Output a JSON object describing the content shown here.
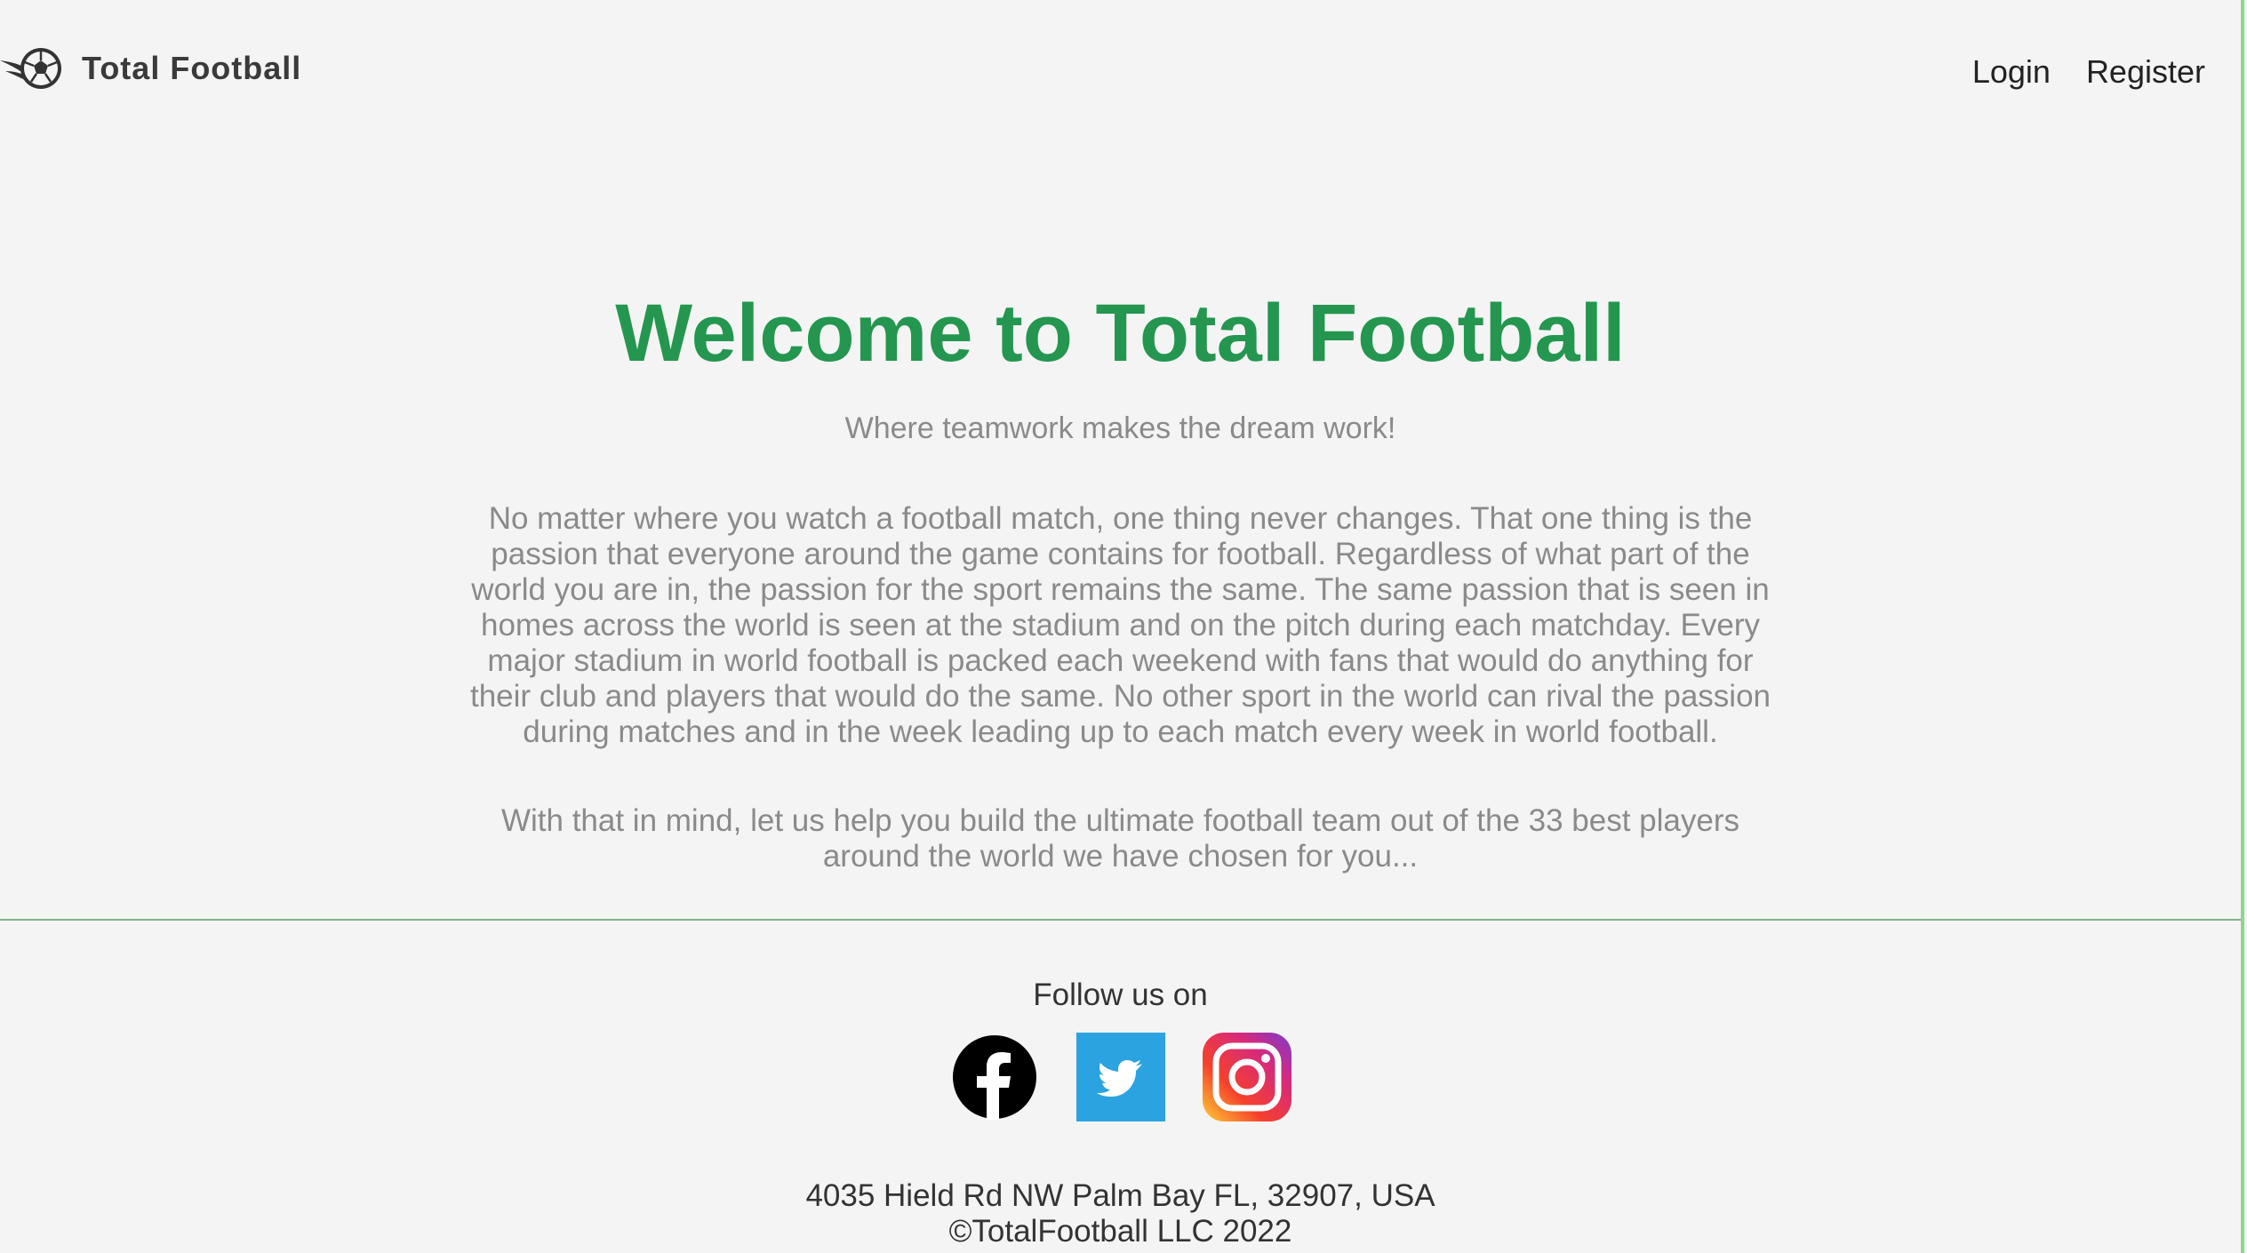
{
  "header": {
    "brand": "Total Football",
    "nav": {
      "login": "Login",
      "register": "Register"
    }
  },
  "hero": {
    "title": "Welcome to Total Football",
    "tagline": "Where teamwork makes the dream work!",
    "paragraph1": "No matter where you watch a football match, one thing never changes. That one thing is the passion that everyone around the game contains for football. Regardless of what part of the world you are in, the passion for the sport remains the same. The same passion that is seen in homes across the world is seen at the stadium and on the pitch during each matchday. Every major stadium in world football is packed each weekend with fans that would do anything for their club and players that would do the same. No other sport in the world can rival the passion during matches and in the week leading up to each match every week in world football.",
    "paragraph2": "With that in mind, let us help you build the ultimate football team out of the 33 best players around the world we have chosen for you..."
  },
  "footer": {
    "follow_label": "Follow us on",
    "socials": [
      {
        "icon": "facebook-icon"
      },
      {
        "icon": "twitter-icon"
      },
      {
        "icon": "instagram-icon"
      }
    ],
    "address": "4035 Hield Rd NW Palm Bay FL, 32907, USA",
    "copyright": "©TotalFootball LLC 2022"
  },
  "colors": {
    "background": "#f4f4f4",
    "accent_green": "#24964f",
    "muted_text": "#8a8a8a",
    "divider": "#7fb48a",
    "twitter_blue": "#2ba3e0"
  }
}
